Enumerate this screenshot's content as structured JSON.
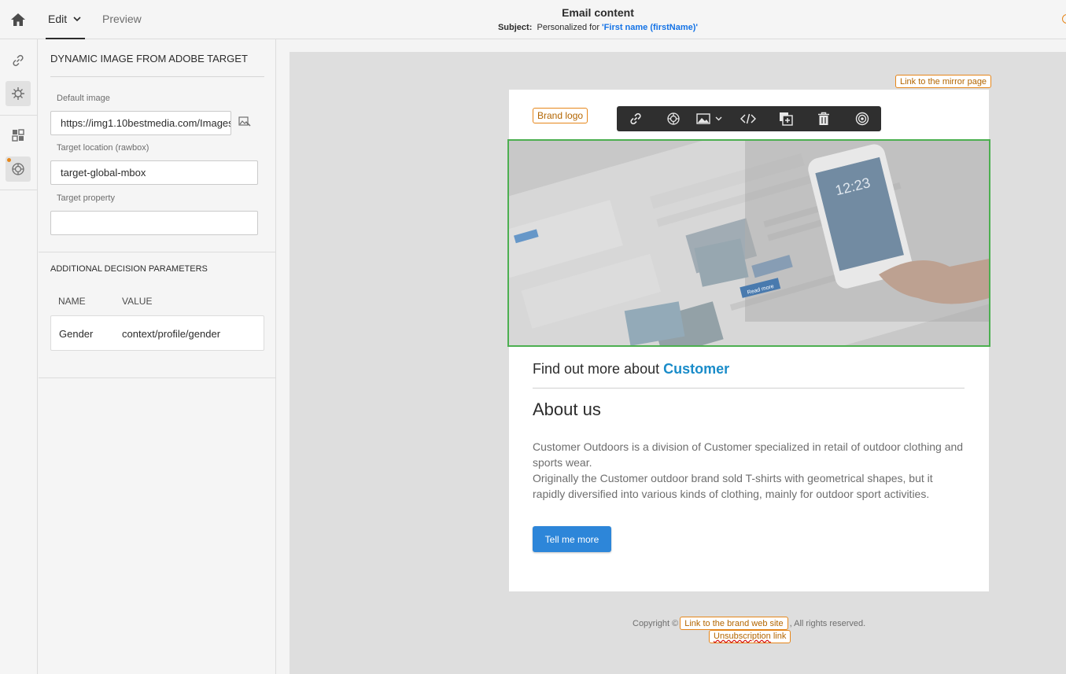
{
  "header": {
    "home_icon": "home-icon",
    "tabs": {
      "edit": "Edit",
      "preview": "Preview"
    },
    "title": "Email content",
    "subject_label": "Subject:",
    "subject_text": "Personalized for ",
    "subject_personalization": "'First name (firstName)'"
  },
  "rail": {
    "icons": [
      "link-icon",
      "target-settings-icon",
      "structure-components-icon",
      "dynamic-target-icon"
    ]
  },
  "panel": {
    "title": "DYNAMIC IMAGE FROM ADOBE TARGET",
    "default_image_label": "Default image",
    "default_image_value": "https://img1.10bestmedia.com/Images/",
    "target_location_label": "Target location (rawbox)",
    "target_location_value": "target-global-mbox",
    "target_property_label": "Target property",
    "target_property_value": "",
    "params_title": "ADDITIONAL DECISION PARAMETERS",
    "params_headers": {
      "name": "NAME",
      "value": "VALUE"
    },
    "params_rows": [
      {
        "name": "Gender",
        "value": "context/profile/gender"
      }
    ]
  },
  "email": {
    "mirror_link": "Link to the mirror page",
    "brand_logo": "Brand logo",
    "toolbar_icons": [
      "link-icon",
      "target-icon",
      "image-icon",
      "html-code-icon",
      "duplicate-icon",
      "delete-icon",
      "fragment-icon"
    ],
    "hero_phone_time": "12:23",
    "hero_button": "Read more",
    "find_more_prefix": "Find out more about ",
    "find_more_highlight": "Customer",
    "about_title": "About us",
    "about_p1": "Customer Outdoors is a division of Customer specialized in retail of outdoor clothing and sports wear.",
    "about_p2": "Originally the Customer outdoor brand sold T-shirts with geometrical shapes, but it rapidly diversified into various kinds of clothing, mainly for outdoor sport activities.",
    "cta": "Tell me more",
    "footer_copyright": "Copyright ©",
    "footer_brand_link": "Link to the brand web site",
    "footer_rights": ", All rights reserved.",
    "footer_unsub_word": "Unsubscription",
    "footer_unsub_rest": " link"
  },
  "colors": {
    "accent_orange": "#e68619",
    "selection_green": "#4caf50",
    "cta_blue": "#2d86d9",
    "highlight_blue": "#1a8cc9"
  }
}
